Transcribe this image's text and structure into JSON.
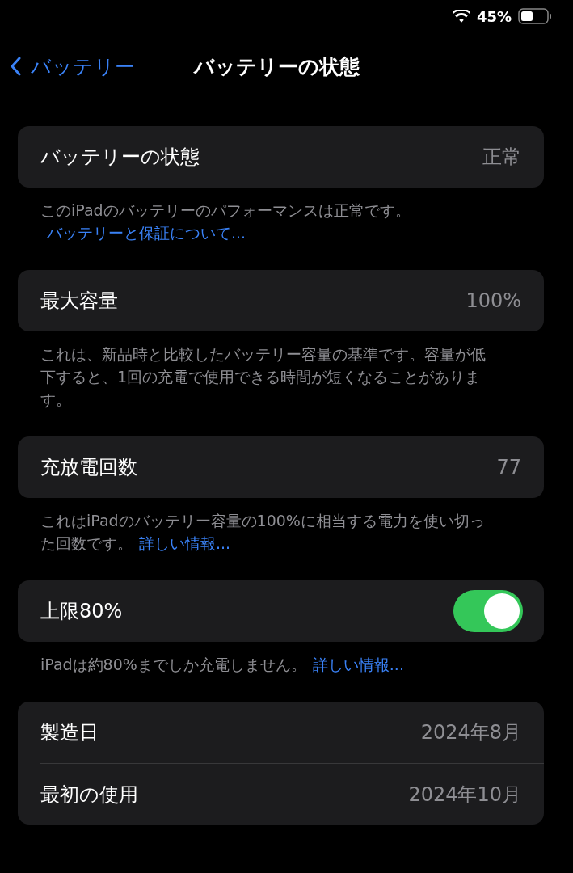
{
  "status_bar": {
    "battery_percent": "45%"
  },
  "nav": {
    "back": "バッテリー",
    "title": "バッテリーの状態"
  },
  "sections": [
    {
      "rows": [
        {
          "kind": "value",
          "label": "バッテリーの状態",
          "value": "正常"
        }
      ],
      "footer": {
        "text": "このiPadのバッテリーのパフォーマンスは正常です。",
        "link": "バッテリーと保証について..."
      }
    },
    {
      "rows": [
        {
          "kind": "value",
          "label": "最大容量",
          "value": "100%"
        }
      ],
      "footer": {
        "text": "これは、新品時と比較したバッテリー容量の基準です。容量が低下すると、1回の充電で使用できる時間が短くなることがあります。"
      }
    },
    {
      "rows": [
        {
          "kind": "value",
          "label": "充放電回数",
          "value": "77"
        }
      ],
      "footer": {
        "text": "これはiPadのバッテリー容量の100%に相当する電力を使い切った回数です。",
        "link": "詳しい情報..."
      }
    },
    {
      "rows": [
        {
          "kind": "toggle",
          "label": "上限80%",
          "on": true
        }
      ],
      "footer": {
        "text": "iPadは約80%までしか充電しません。",
        "link": "詳しい情報..."
      }
    },
    {
      "rows": [
        {
          "kind": "value",
          "label": "製造日",
          "value": "2024年8月"
        },
        {
          "kind": "value",
          "label": "最初の使用",
          "value": "2024年10月"
        }
      ]
    }
  ]
}
